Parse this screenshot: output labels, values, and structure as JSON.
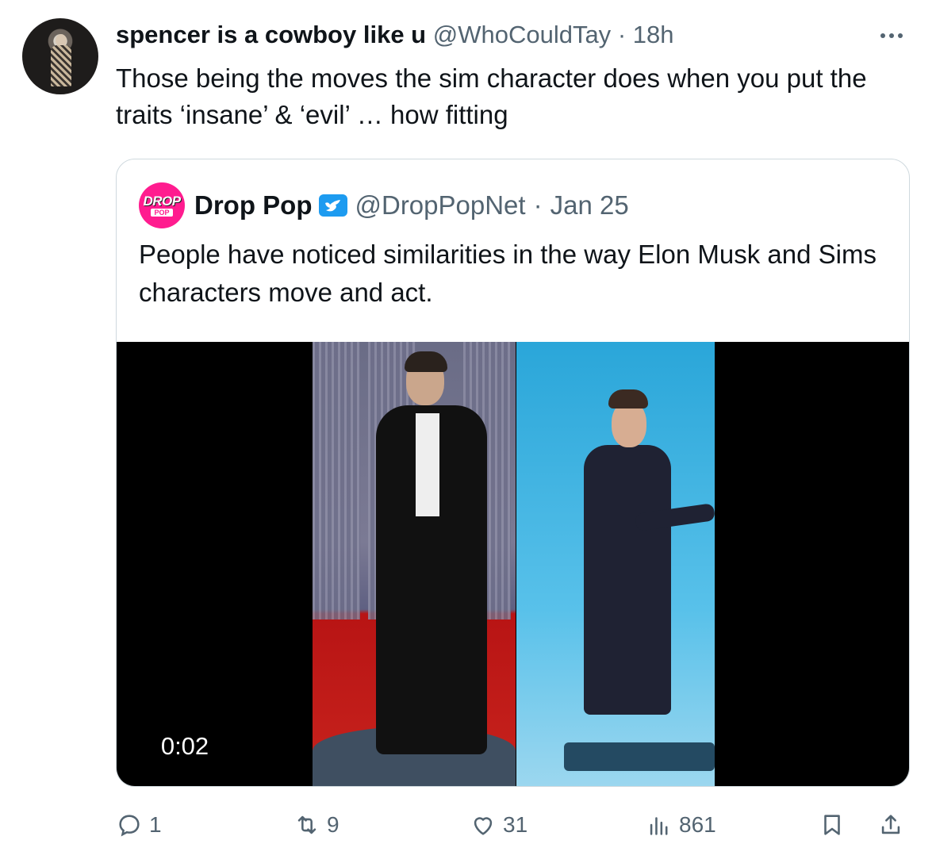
{
  "tweet": {
    "author_name": "spencer is a cowboy like u",
    "author_handle": "@WhoCouldTay",
    "separator": "·",
    "time": "18h",
    "text": "Those being the moves the sim character does when you put the traits ‘insane’ & ‘evil’ … how fitting"
  },
  "quote": {
    "avatar_text_top": "DROP",
    "avatar_text_bottom": "POP",
    "author_name": "Drop Pop",
    "author_handle": "@DropPopNet",
    "separator": "·",
    "date": "Jan 25",
    "text": "People have noticed similarities in the way Elon Musk and Sims characters move and act.",
    "video": {
      "timestamp": "0:02"
    }
  },
  "actions": {
    "replies": "1",
    "retweets": "9",
    "likes": "31",
    "views": "861"
  },
  "colors": {
    "text": "#0f1419",
    "muted": "#536471",
    "border": "#cfd9de",
    "verified": "#1d9bf0",
    "brand_pink": "#ff1c8f"
  },
  "icons": [
    "more-icon",
    "verified-badge-icon",
    "reply-icon",
    "retweet-icon",
    "like-icon",
    "views-icon",
    "bookmark-icon",
    "share-icon"
  ]
}
